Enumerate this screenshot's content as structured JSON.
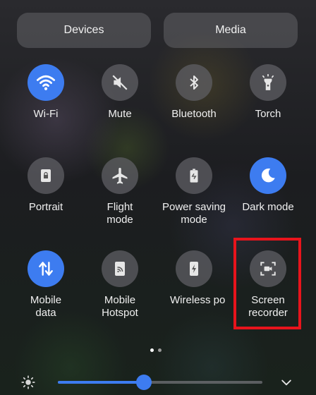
{
  "header": {
    "devices_label": "Devices",
    "media_label": "Media"
  },
  "tiles": [
    {
      "label": "Wi-Fi",
      "icon": "wifi-icon",
      "on": true
    },
    {
      "label": "Mute",
      "icon": "mute-icon",
      "on": false
    },
    {
      "label": "Bluetooth",
      "icon": "bluetooth-icon",
      "on": false
    },
    {
      "label": "Torch",
      "icon": "torch-icon",
      "on": false
    },
    {
      "label": "Portrait",
      "icon": "portrait-lock-icon",
      "on": false
    },
    {
      "label": "Flight\nmode",
      "icon": "airplane-icon",
      "on": false
    },
    {
      "label": "Power saving\nmode",
      "icon": "battery-saver-icon",
      "on": false
    },
    {
      "label": "Dark mode",
      "icon": "moon-icon",
      "on": true
    },
    {
      "label": "Mobile\ndata",
      "icon": "mobile-data-icon",
      "on": true
    },
    {
      "label": "Mobile\nHotspot",
      "icon": "hotspot-icon",
      "on": false
    },
    {
      "label": "Wireless po",
      "icon": "wireless-power-icon",
      "on": false
    },
    {
      "label": "Screen\nrecorder",
      "icon": "screen-recorder-icon",
      "on": false
    }
  ],
  "pager": {
    "total": 2,
    "current": 1
  },
  "brightness": {
    "level": 0.42,
    "icon": "brightness-icon"
  },
  "expand_icon": "chevron-down-icon",
  "colors": {
    "accent": "#3d7cf0",
    "highlight": "#e8141c"
  }
}
